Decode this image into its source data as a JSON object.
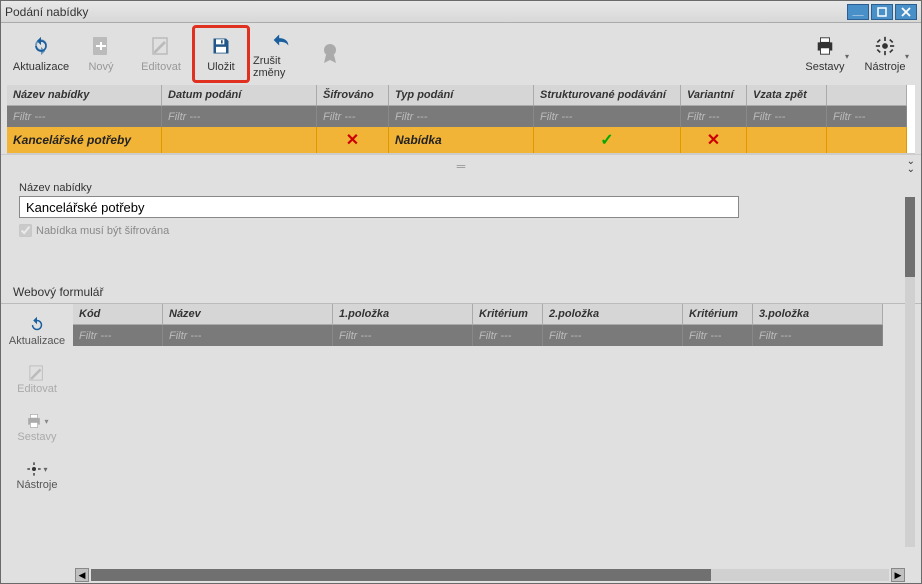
{
  "window": {
    "title": "Podání nabídky"
  },
  "toolbar": {
    "refresh": "Aktualizace",
    "new": "Nový",
    "edit": "Editovat",
    "save": "Uložit",
    "undo": "Zrušit změny",
    "reports": "Sestavy",
    "tools": "Nástroje"
  },
  "grid1": {
    "headers": {
      "name": "Název nabídky",
      "date": "Datum podání",
      "encrypted": "Šifrováno",
      "type": "Typ podání",
      "structured": "Strukturované podávání",
      "variant": "Variantní",
      "withdrawn": "Vzata zpět",
      "extra": ""
    },
    "filter": "Filtr ---",
    "row": {
      "name": "Kancelářské potřeby",
      "date": "",
      "encrypted_mark": "✕",
      "type": "Nabídka",
      "structured_mark": "✓",
      "variant_mark": "✕",
      "withdrawn": "",
      "extra": ""
    }
  },
  "form": {
    "name_label": "Název nabídky",
    "name_value": "Kancelářské potřeby",
    "encrypt_label": "Nabídka musí být šifrována"
  },
  "section2": "Webový formulář",
  "side": {
    "refresh": "Aktualizace",
    "edit": "Editovat",
    "reports": "Sestavy",
    "tools": "Nástroje"
  },
  "grid2": {
    "headers": {
      "code": "Kód",
      "name": "Název",
      "p1": "1.položka",
      "k1": "Kritérium",
      "p2": "2.položka",
      "k2": "Kritérium",
      "p3": "3.položka"
    },
    "filter": "Filtr ---"
  }
}
